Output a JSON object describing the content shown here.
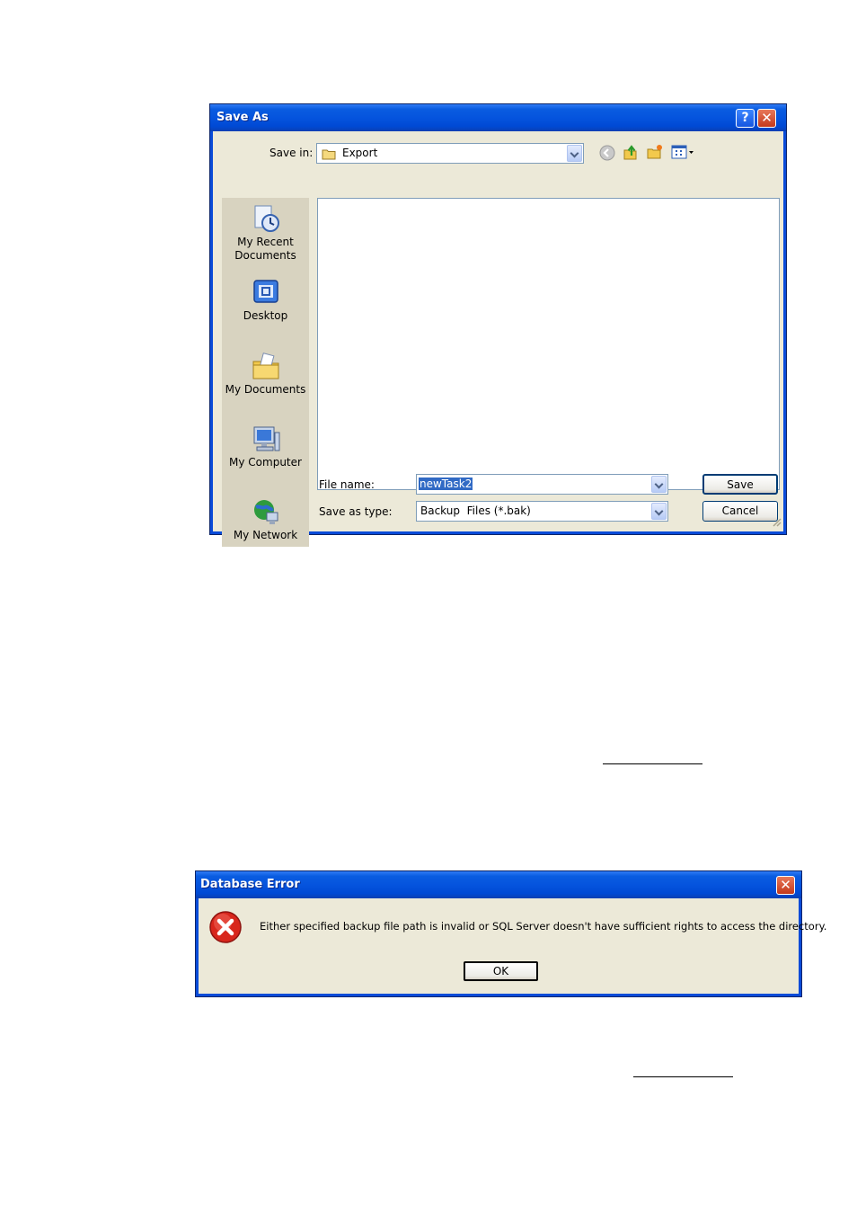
{
  "save_as": {
    "title": "Save As",
    "help_glyph": "?",
    "close_glyph": "✕",
    "save_in_label": "Save in:",
    "save_in_value": "Export",
    "places": [
      {
        "label_line1": "My Recent",
        "label_line2": "Documents",
        "icon": "recent-documents-icon"
      },
      {
        "label_line1": "Desktop",
        "label_line2": "",
        "icon": "desktop-icon"
      },
      {
        "label_line1": "My Documents",
        "label_line2": "",
        "icon": "my-documents-icon"
      },
      {
        "label_line1": "My Computer",
        "label_line2": "",
        "icon": "my-computer-icon"
      },
      {
        "label_line1": "My Network",
        "label_line2": "",
        "icon": "my-network-icon"
      }
    ],
    "file_name_label": "File name:",
    "file_name_value": "newTask2",
    "save_as_type_label": "Save as type:",
    "save_as_type_value": "Backup  Files (*.bak)",
    "save_button": "Save",
    "cancel_button": "Cancel"
  },
  "database_error": {
    "title": "Database Error",
    "close_glyph": "✕",
    "message": "Either specified backup file path is invalid or SQL Server doesn't have sufficient rights to access the directory.",
    "ok_button": "OK",
    "icon": "error-icon"
  },
  "colors": {
    "titlebar": "#0554de",
    "dialog_face": "#ece9d8",
    "error_red": "#d8261c"
  }
}
